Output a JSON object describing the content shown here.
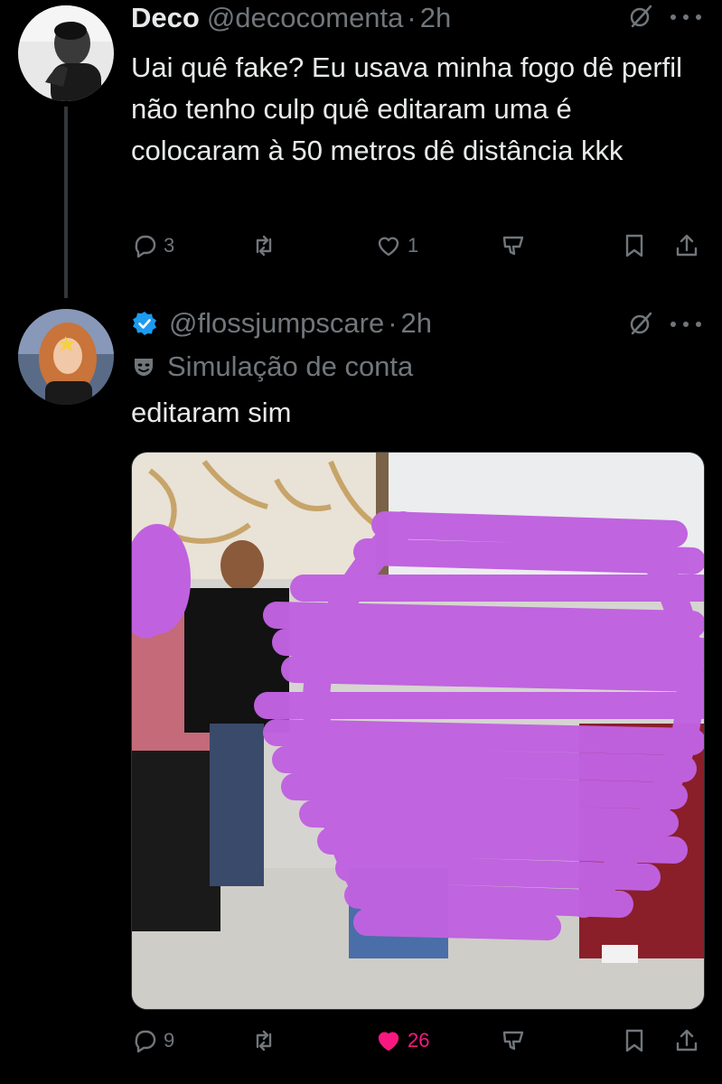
{
  "colors": {
    "background": "#000000",
    "text": "#e7e9ea",
    "muted": "#71767b",
    "verified": "#1d9bf0",
    "like": "#f91880",
    "scribble": "#c062e0"
  },
  "tweets": [
    {
      "name": "Deco",
      "handle": "@decocomenta",
      "separator": "·",
      "time": "2h",
      "text": "Uai quê fake? Eu usava minha fogo dê perfil não tenho culp quê editaram uma é colocaram à 50 metros dê distância kkk",
      "actions": {
        "replies": "3",
        "retweets": "",
        "likes": "1",
        "views": ""
      }
    },
    {
      "name": "",
      "handle": "@flossjumpscare",
      "separator": "·",
      "time": "2h",
      "verified": true,
      "label": "Simulação de conta",
      "text": "editaram sim",
      "actions": {
        "replies": "9",
        "retweets": "",
        "likes": "26",
        "views": ""
      }
    }
  ],
  "icons": [
    "reply-icon",
    "retweet-icon",
    "like-icon",
    "views-icon",
    "bookmark-icon",
    "share-icon",
    "grok-icon",
    "more-icon",
    "parody-mask-icon",
    "verified-badge-icon"
  ]
}
